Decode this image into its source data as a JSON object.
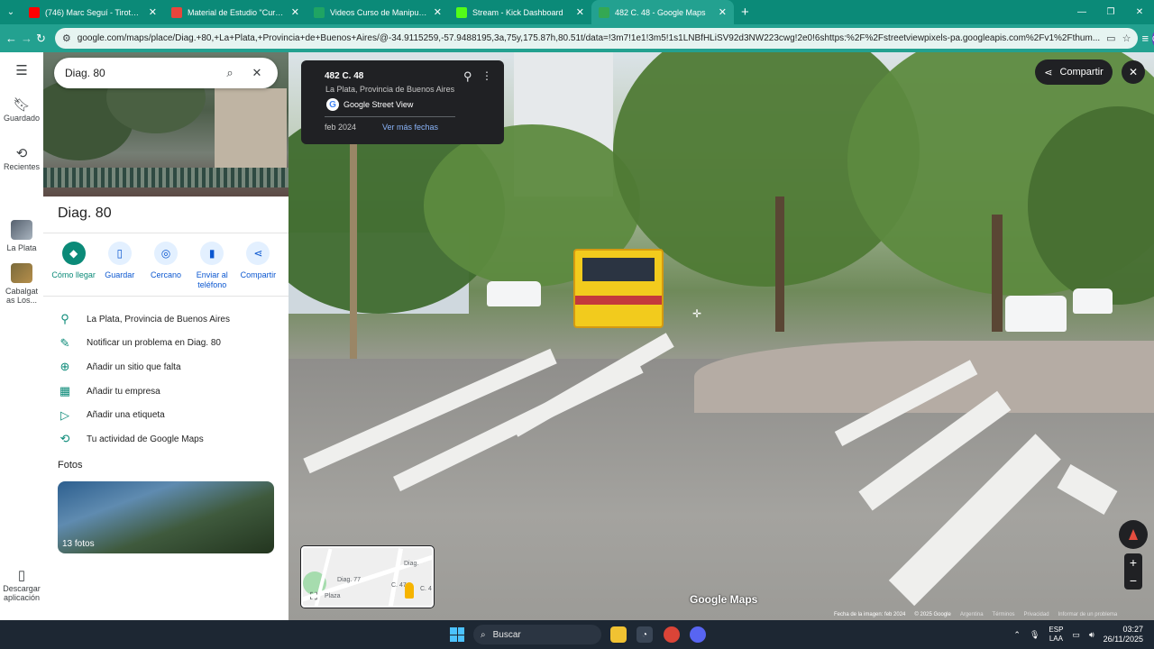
{
  "browser": {
    "tabs": [
      {
        "label": "(746) Marc Seguí - Tiroteo Rem",
        "favicon_color": "#ff0000"
      },
      {
        "label": "Material de Estudio \"Curso de M",
        "favicon_color": "#e8453c"
      },
      {
        "label": "Videos Curso de Manipulación",
        "favicon_color": "#1fa463"
      },
      {
        "label": "Stream - Kick Dashboard",
        "favicon_color": "#53fc18"
      },
      {
        "label": "482 C. 48 - Google Maps",
        "favicon_color": "#34a853"
      }
    ],
    "new_tab_symbol": "+",
    "url": "google.com/maps/place/Diag.+80,+La+Plata,+Provincia+de+Buenos+Aires/@-34.9115259,-57.9488195,3a,75y,175.87h,80.51t/data=!3m7!1e1!3m5!1s1LNBfHLiSV92d3NW223cwg!2e0!6shttps:%2F%2Fstreetviewpixels-pa.googleapis.com%2Fv1%2Fthum...",
    "profile_initial": "C",
    "theme_color": "#23a190"
  },
  "rail": {
    "items": [
      {
        "label": "Guardado",
        "icon": "bookmark-icon"
      },
      {
        "label": "Recientes",
        "icon": "history-icon"
      },
      {
        "label": "La Plata",
        "icon": "thumbnail"
      },
      {
        "label": "Cabalgat as Los...",
        "icon": "thumbnail"
      },
      {
        "label": "Descargar aplicación",
        "icon": "phone-icon"
      }
    ]
  },
  "panel": {
    "search_value": "Diag. 80",
    "title": "Diag. 80",
    "actions": [
      {
        "label": "Cómo llegar",
        "icon": "directions-icon"
      },
      {
        "label": "Guardar",
        "icon": "bookmark-icon"
      },
      {
        "label": "Cercano",
        "icon": "nearby-icon"
      },
      {
        "label": "Enviar al teléfono",
        "icon": "send-to-phone-icon"
      },
      {
        "label": "Compartir",
        "icon": "share-icon"
      }
    ],
    "info": [
      {
        "text": "La Plata, Provincia de Buenos Aires",
        "icon": "location-pin-icon"
      },
      {
        "text": "Notificar un problema en Diag. 80",
        "icon": "pencil-icon"
      },
      {
        "text": "Añadir un sitio que falta",
        "icon": "add-place-icon"
      },
      {
        "text": "Añadir tu empresa",
        "icon": "add-business-icon"
      },
      {
        "text": "Añadir una etiqueta",
        "icon": "label-icon"
      },
      {
        "text": "Tu actividad de Google Maps",
        "icon": "history-icon"
      }
    ],
    "photos_title": "Fotos",
    "photos_count": "13 fotos"
  },
  "streetview": {
    "address": "482 C. 48",
    "locality": "La Plata, Provincia de Buenos Aires",
    "source": "Google Street View",
    "date": "feb 2024",
    "more_dates": "Ver más fechas",
    "share_label": "Compartir",
    "logo": "Google Maps",
    "footer": [
      "Fecha de la imagen: feb 2024",
      "© 2025 Google",
      "Argentina",
      "Términos",
      "Privacidad",
      "Informar de un problema"
    ],
    "minimap_labels": [
      "Diag. 77",
      "Diag.",
      "C. 47",
      "C. 4",
      "Plaza"
    ]
  },
  "taskbar": {
    "search_placeholder": "Buscar",
    "lang_line1": "ESP",
    "lang_line2": "LAA",
    "time": "03:27",
    "date": "26/11/2025"
  }
}
